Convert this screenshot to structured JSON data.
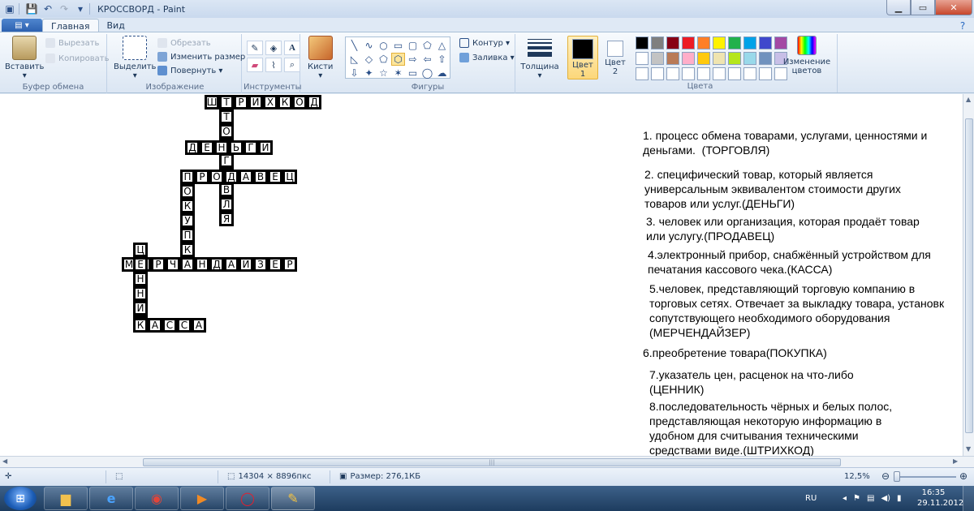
{
  "window": {
    "title": "КРОССВОРД - Paint",
    "minimize_icon": "minimize-icon",
    "maximize_icon": "maximize-icon",
    "close_icon": "close-icon"
  },
  "tabs": [
    {
      "label": "Главная",
      "active": true
    },
    {
      "label": "Вид",
      "active": false
    }
  ],
  "ribbon": {
    "clipboard": {
      "label": "Буфер обмена",
      "paste": "Вставить",
      "cut": "Вырезать",
      "copy": "Копировать"
    },
    "image": {
      "label": "Изображение",
      "select": "Выделить",
      "crop": "Обрезать",
      "resize": "Изменить размер",
      "rotate": "Повернуть"
    },
    "tools": {
      "label": "Инструменты",
      "brushes": "Кисти",
      "items": [
        "pencil-icon",
        "fill-icon",
        "text-icon",
        "eraser-icon",
        "color-picker-icon",
        "magnifier-icon"
      ]
    },
    "shapes": {
      "label": "Фигуры",
      "outline": "Контур",
      "fill": "Заливка",
      "glyphs": [
        "╲",
        "∿",
        "○",
        "▭",
        "▢",
        "⬠",
        "△",
        "◺",
        "◇",
        "⬠",
        "⬡",
        "⇨",
        "⇦",
        "⇧",
        "⇩",
        "✦",
        "☆",
        "✶",
        "▭",
        "◯",
        "☁"
      ],
      "selected_index": 10
    },
    "size": {
      "label": "Толщина"
    },
    "colors": {
      "label": "Цвета",
      "color1": "Цвет 1",
      "color2": "Цвет 2",
      "edit": "Изменение цветов",
      "color1_value": "#000000",
      "color2_value": "#ffffff",
      "palette": [
        "#000000",
        "#7f7f7f",
        "#880015",
        "#ed1c24",
        "#ff7f27",
        "#fff200",
        "#22b14c",
        "#00a2e8",
        "#3f48cc",
        "#a349a4",
        "#ffffff",
        "#c3c3c3",
        "#b97a57",
        "#ffaec9",
        "#ffc90e",
        "#efe4b0",
        "#b5e61d",
        "#99d9ea",
        "#7092be",
        "#c8bfe7",
        "#ffffff",
        "#ffffff",
        "#ffffff",
        "#ffffff",
        "#ffffff",
        "#ffffff",
        "#ffffff",
        "#ffffff",
        "#ffffff",
        "#ffffff"
      ]
    }
  },
  "crossword": {
    "words": [
      {
        "word": "ШТРИХКОД",
        "direction": "across"
      },
      {
        "word": "ТОРГОВЛЯ",
        "direction": "down"
      },
      {
        "word": "ДЕНЬГИ",
        "direction": "across"
      },
      {
        "word": "ПРОДАВЕЦ",
        "direction": "across"
      },
      {
        "word": "ПОКУПКА",
        "direction": "down"
      },
      {
        "word": "МЕРЧЕНДАЙЗЕР",
        "direction": "across"
      },
      {
        "word": "ЦЕННИК",
        "direction": "down"
      },
      {
        "word": "КАССА",
        "direction": "across"
      }
    ]
  },
  "clues": [
    "1. процесс обмена товарами, услугами, ценностями и",
    "деньгами.  (ТОРГОВЛЯ)",
    "2. специфический товар, который является",
    "универсальным эквивалентом стоимости других",
    "товаров или услуг.(ДЕНЬГИ)",
    "3. человек или организация, которая продаёт товар",
    "или услугу.(ПРОДАВЕЦ)",
    "4.электронный прибор, снабжённый устройством для",
    "печатания кассового чека.(КАССА)",
    "5.человек, представляющий торговую компанию в",
    "торговых сетях. Отвечает за выкладку товара, установк",
    "сопутствующего необходимого оборудования",
    "(МЕРЧЕНДАЙЗЕР)",
    "6.преобретение товара(ПОКУПКА)",
    "7.указатель цен, расценок на что-либо",
    "(ЦЕННИК)",
    "8.последовательность чёрных и белых полос,",
    "представляющая некоторую информацию в",
    "удобном для считывания техническими",
    "средствами виде.(ШТРИХКОД)"
  ],
  "status": {
    "dimensions": "14304 × 8896пкс",
    "size": "Размер: 276,1КБ",
    "zoom": "12,5%"
  },
  "taskbar": {
    "apps": [
      "explorer-icon",
      "ie-icon",
      "chrome-icon",
      "media-player-icon",
      "opera-icon",
      "paint-icon"
    ],
    "lang": "RU",
    "time": "16:35",
    "date": "29.11.2012"
  }
}
